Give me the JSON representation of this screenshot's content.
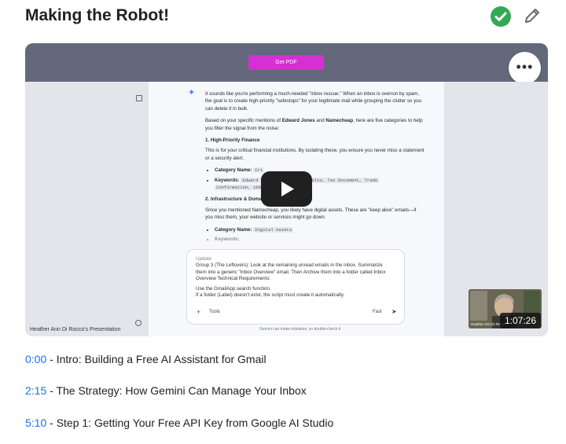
{
  "page": {
    "title": "Making the Robot!"
  },
  "icons": {
    "status": "check-circle-icon",
    "edit": "pencil-icon",
    "play": "play-icon",
    "more": "more-horizontal-icon"
  },
  "colors": {
    "accent": "#1a73e8",
    "check": "#34a853",
    "get_pdf": "#d62fd3"
  },
  "video": {
    "get_pdf_label": "Get PDF",
    "more_label": "•••",
    "presenter_label": "Heather Ann Di Rocco's Presentation",
    "thumbnail_name": "Heather Ann Di Rocco",
    "duration": "1:07:26",
    "disclaimer": "Gemini can make mistakes, so double-check it",
    "doc": {
      "intro": "It sounds like you're performing a much-needed \"inbox rescue.\" When an inbox is overrun by spam, the goal is to create high-priority \"safestops\" for your legitimate mail while grouping the clutter so you can delete it in bulk.",
      "mention_pre": "Based on your specific mentions of ",
      "mention_name1": "Edward Jones",
      "mention_and": " and ",
      "mention_name2": "Namecheap",
      "mention_post": ", here are five categories to help you filter the signal from the noise:",
      "s1_title": "1. High-Priority Finance",
      "s1_body": "This is for your critical financial institutions. By isolating these, you ensure you never miss a statement or a security alert.",
      "s1_cat_label": "Category Name:",
      "s1_cat_value": "Cri",
      "s1_kw_label": "Keywords:",
      "s1_kw_value1": "Edward J",
      "s1_kw_value2": "folio, Tax Document, Trade",
      "s1_kw_value3": "Confirmation, 1099",
      "s2_title": "2. Infrastructure & Domains",
      "s2_body": "Since you mentioned Namecheap, you likely have digital assets. These are \"keep alive\" emails—if you miss them, your website or services might go down.",
      "s2_cat_label": "Category Name:",
      "s2_cat_value": "Digital Assets",
      "s2_kw_label": "Keywords:"
    },
    "input": {
      "top": "Update",
      "line1": "Group 3 (The Leftovers): Look at the remaining unread emails in the inbox. Summarize them into a generic \"Inbox Overview\" email. Then Archive them into a folder called Inbox Overview Technical Requirements:",
      "line2": "Use the GmailApp.search function.",
      "line3": "If a folder (Label) doesn't exist, the script must create it automatically.",
      "tools_label": "Tools",
      "fast_label": "Fast",
      "plus": "+",
      "send": "➤"
    }
  },
  "chapters": [
    {
      "time": "0:00",
      "title": " - Intro: Building a Free AI Assistant for Gmail"
    },
    {
      "time": "2:15",
      "title": " - The Strategy: How Gemini Can Manage Your Inbox"
    },
    {
      "time": "5:10",
      "title": " - Step 1: Getting Your Free API Key from Google AI Studio"
    }
  ]
}
